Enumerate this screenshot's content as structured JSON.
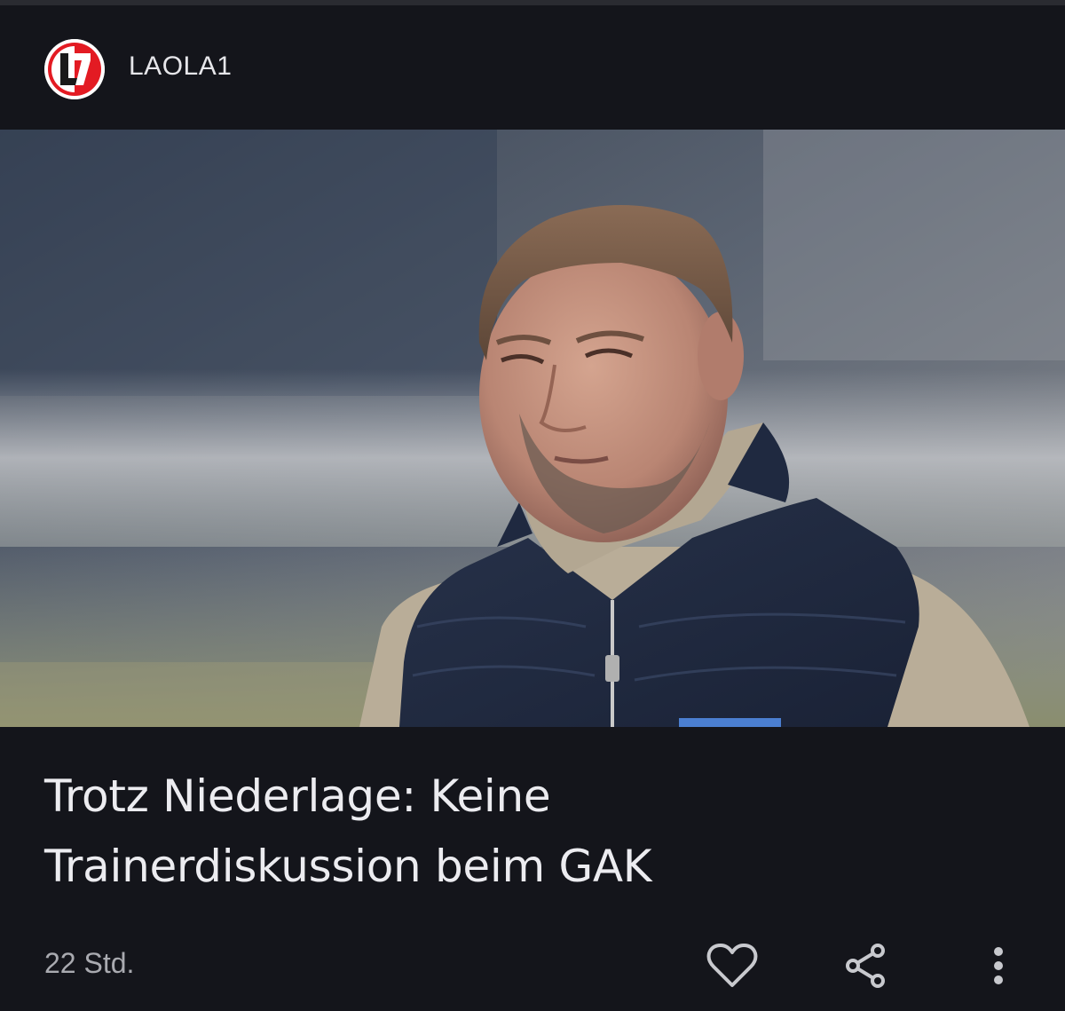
{
  "source": {
    "name": "LAOLA1",
    "logo_icon": "laola1-logo",
    "logo_text": "L1",
    "logo_color": "#e31b23"
  },
  "hero_image": {
    "icon": "article-photo"
  },
  "article": {
    "headline_line1": "Trotz Niederlage: Keine",
    "headline_line2": "Trainerdiskussion beim GAK",
    "timestamp": "22 Std."
  },
  "actions": {
    "like_icon": "heart-icon",
    "share_icon": "share-icon",
    "more_icon": "more-vertical-icon"
  },
  "colors": {
    "background": "#14151b",
    "text_primary": "#ececf0",
    "text_secondary": "#a9aab0",
    "icon": "#c8c9ce"
  }
}
